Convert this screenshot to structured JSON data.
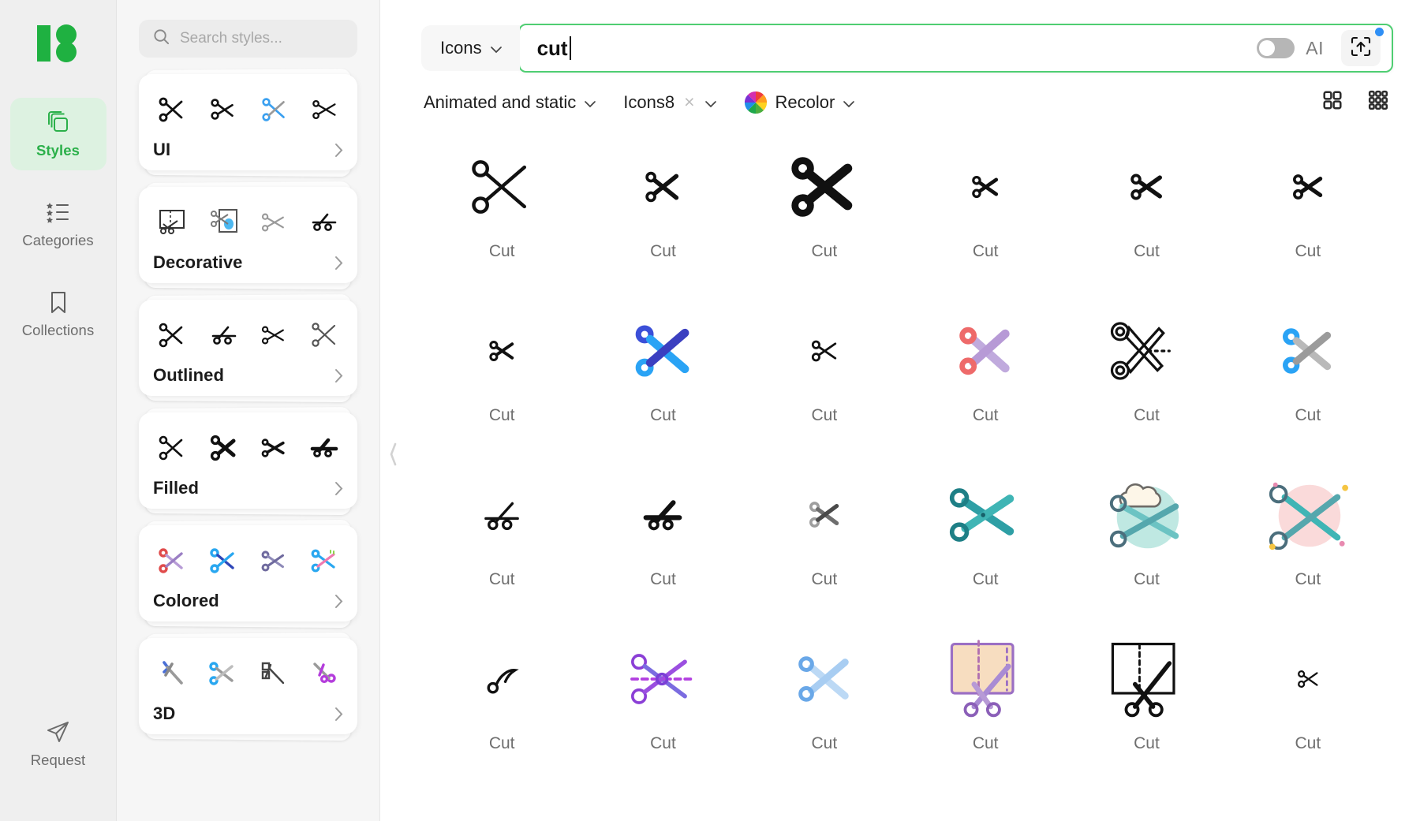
{
  "app": {
    "brand_name": "Icons8",
    "brand_color": "#22c55e"
  },
  "sidebar": {
    "items": [
      {
        "label": "Styles",
        "icon": "layers-icon",
        "active": true
      },
      {
        "label": "Categories",
        "icon": "star-list-icon",
        "active": false
      },
      {
        "label": "Collections",
        "icon": "bookmark-icon",
        "active": false
      }
    ],
    "bottom": {
      "label": "Request",
      "icon": "paper-plane-icon"
    }
  },
  "styles_panel": {
    "search": {
      "placeholder": "Search styles...",
      "value": "",
      "icon": "search-icon"
    },
    "cards": [
      {
        "name": "UI",
        "chevron": "chevron-right-icon"
      },
      {
        "name": "Decorative",
        "chevron": "chevron-right-icon"
      },
      {
        "name": "Outlined",
        "chevron": "chevron-right-icon"
      },
      {
        "name": "Filled",
        "chevron": "chevron-right-icon"
      },
      {
        "name": "Colored",
        "chevron": "chevron-right-icon"
      },
      {
        "name": "3D",
        "chevron": "chevron-right-icon"
      }
    ]
  },
  "topbar": {
    "kind_select": {
      "label": "Icons",
      "chevron": "chevron-down-icon"
    },
    "search": {
      "value": "cut",
      "has_caret": true
    },
    "ai_toggle": {
      "label": "AI",
      "state": "off"
    },
    "upload_button": {
      "icon": "scan-upload-icon",
      "badge": "new-dot"
    }
  },
  "filterbar": {
    "filters": [
      {
        "label": "Animated and static",
        "chevron": "chevron-down-icon",
        "clearable": false
      },
      {
        "label": "Icons8",
        "chevron": "chevron-down-icon",
        "clearable": true,
        "clear_glyph": "×"
      },
      {
        "label": "Recolor",
        "chevron": "chevron-down-icon",
        "clearable": false,
        "icon": "color-wheel-icon"
      }
    ],
    "view_modes": [
      {
        "name": "grid-large",
        "icon": "grid-2x2-icon",
        "active": false
      },
      {
        "name": "grid-small",
        "icon": "grid-3x3-icon",
        "active": true
      }
    ]
  },
  "collapse_handle": {
    "icon": "chevron-left-icon"
  },
  "results": {
    "label": "Cut",
    "items": [
      {
        "id": 1,
        "label": "Cut",
        "style": "outline-thin-large"
      },
      {
        "id": 2,
        "label": "Cut",
        "style": "solid-small"
      },
      {
        "id": 3,
        "label": "Cut",
        "style": "solid-bold-large"
      },
      {
        "id": 4,
        "label": "Cut",
        "style": "solid-tiny"
      },
      {
        "id": 5,
        "label": "Cut",
        "style": "solid-small-b"
      },
      {
        "id": 6,
        "label": "Cut",
        "style": "solid-small-c"
      },
      {
        "id": 7,
        "label": "Cut",
        "style": "solid-mini"
      },
      {
        "id": 8,
        "label": "Cut",
        "style": "two-tone-blue"
      },
      {
        "id": 9,
        "label": "Cut",
        "style": "outline-mini"
      },
      {
        "id": 10,
        "label": "Cut",
        "style": "colored-red-violet"
      },
      {
        "id": 11,
        "label": "Cut",
        "style": "outline-double-large"
      },
      {
        "id": 12,
        "label": "Cut",
        "style": "blue-grey"
      },
      {
        "id": 13,
        "label": "Cut",
        "style": "outline-side"
      },
      {
        "id": 14,
        "label": "Cut",
        "style": "solid-side"
      },
      {
        "id": 15,
        "label": "Cut",
        "style": "grey-gradient"
      },
      {
        "id": 16,
        "label": "Cut",
        "style": "teal-flat"
      },
      {
        "id": 17,
        "label": "Cut",
        "style": "teal-cloud-scene"
      },
      {
        "id": 18,
        "label": "Cut",
        "style": "teal-pink-scene"
      },
      {
        "id": 19,
        "label": "Cut",
        "style": "outline-curl"
      },
      {
        "id": 20,
        "label": "Cut",
        "style": "purple-dashed"
      },
      {
        "id": 21,
        "label": "Cut",
        "style": "light-blue-flat"
      },
      {
        "id": 22,
        "label": "Cut",
        "style": "paper-purple"
      },
      {
        "id": 23,
        "label": "Cut",
        "style": "paper-outline"
      },
      {
        "id": 24,
        "label": "Cut",
        "style": "tiny-outline"
      }
    ]
  },
  "colors": {
    "accent_green": "#2bb04a",
    "search_border": "#4fce72",
    "rail_bg": "#efefef",
    "panel_bg": "#f6f6f6",
    "badge_blue": "#2f8ff5"
  }
}
